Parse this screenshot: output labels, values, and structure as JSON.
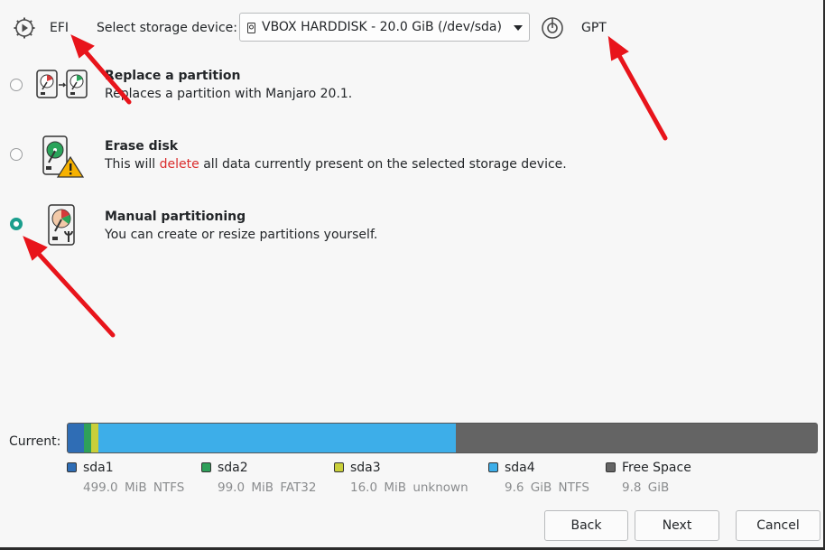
{
  "topbar": {
    "firmware_label": "EFI",
    "select_label": "Select storage device:",
    "device_value": "VBOX HARDDISK - 20.0 GiB (/dev/sda)",
    "partition_table_label": "GPT"
  },
  "options": [
    {
      "title": "Replace a partition",
      "desc": "Replaces a partition with Manjaro 20.1.",
      "checked": false
    },
    {
      "title": "Erase disk",
      "desc_pre": "This will ",
      "desc_danger": "delete",
      "desc_post": " all data currently present on the selected storage device.",
      "checked": false
    },
    {
      "title": "Manual partitioning",
      "desc": "You can create or resize partitions yourself.",
      "checked": true
    }
  ],
  "partition_view": {
    "label": "Current:",
    "partitions": [
      {
        "name": "sda1",
        "size": "499.0 MiB",
        "fs": "NTFS",
        "color": "#2f6db5"
      },
      {
        "name": "sda2",
        "size": "99.0 MiB",
        "fs": "FAT32",
        "color": "#2fa05a"
      },
      {
        "name": "sda3",
        "size": "16.0 MiB",
        "fs": "unknown",
        "color": "#c9cf3a"
      },
      {
        "name": "sda4",
        "size": "9.6 GiB",
        "fs": "NTFS",
        "color": "#3daee9"
      },
      {
        "name": "Free Space",
        "size": "9.8 GiB",
        "fs": "",
        "color": "#646464"
      }
    ]
  },
  "buttons": {
    "back": "Back",
    "next": "Next",
    "cancel": "Cancel"
  },
  "colors": {
    "accent": "#1a9e8d",
    "danger": "#da2c2c",
    "annotation": "#e8141b"
  }
}
